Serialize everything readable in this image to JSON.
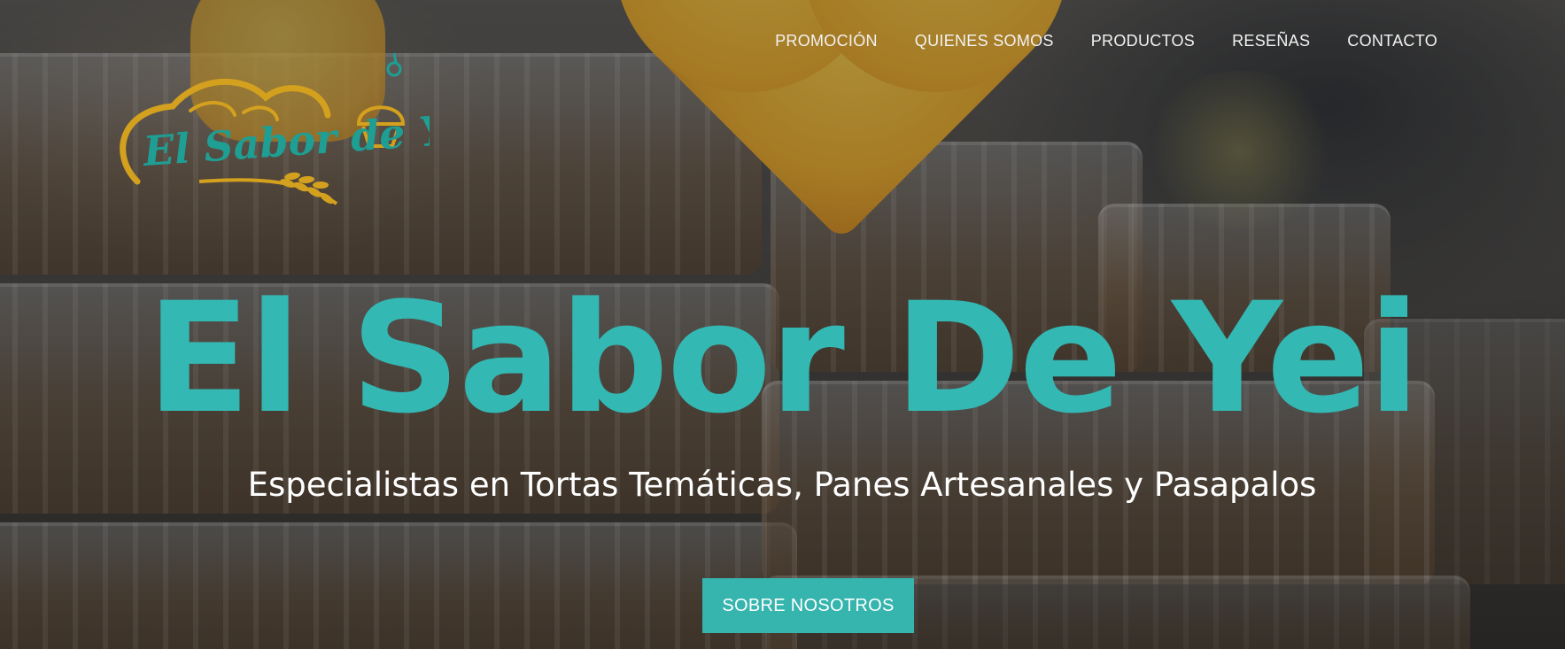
{
  "brand": {
    "logo_text": "El Sabor de Yei",
    "logo_colors": {
      "script": "#1f9e93",
      "accent": "#d4a11e"
    }
  },
  "nav": {
    "items": [
      {
        "label": "PROMOCIÓN"
      },
      {
        "label": "QUIENES SOMOS"
      },
      {
        "label": "PRODUCTOS"
      },
      {
        "label": "RESEÑAS"
      },
      {
        "label": "CONTACTO"
      }
    ]
  },
  "hero": {
    "title": "El Sabor De Yei",
    "subtitle": "Especialistas en Tortas Temáticas, Panes Artesanales y Pasapalos",
    "cta_label": "SOBRE NOSOTROS"
  },
  "colors": {
    "accent": "#34b8b3",
    "heart": "#f0b93a",
    "nav_text": "#f2f2f2"
  }
}
